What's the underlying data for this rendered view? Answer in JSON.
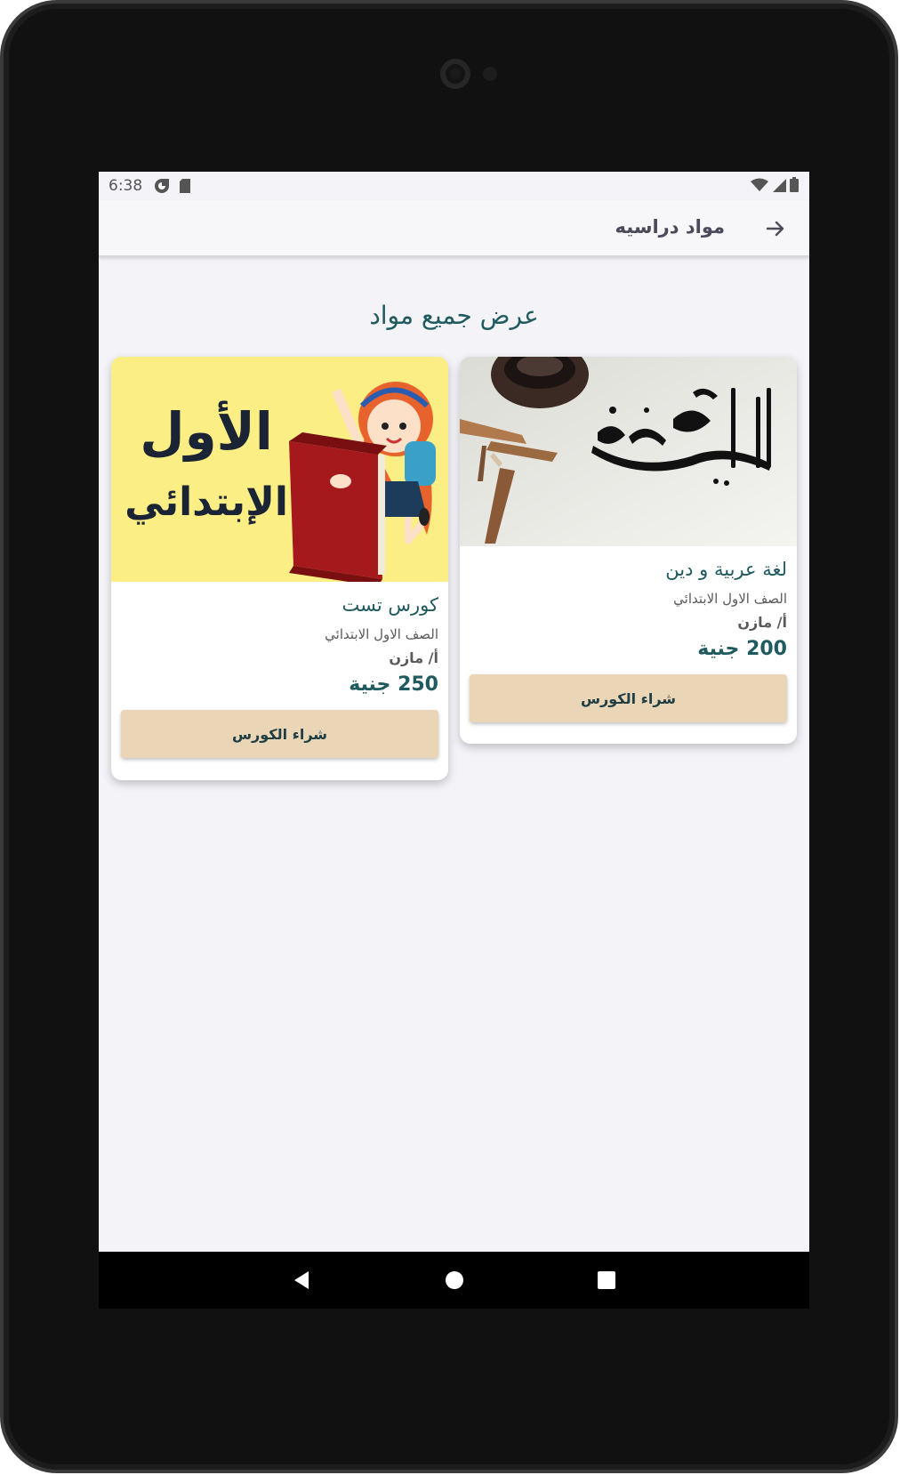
{
  "status_bar": {
    "time": "6:38"
  },
  "app_bar": {
    "title": "مواد دراسيه"
  },
  "section": {
    "title": "عرض جميع مواد"
  },
  "courses": [
    {
      "title": "لغة عربية و دين",
      "grade": "الصف الاول الابتدائي",
      "teacher": "أ/ مازن",
      "price": "200 جنية",
      "button": "شراء الكورس",
      "image_text": "اللغة العربية"
    },
    {
      "title": "كورس تست",
      "grade": "الصف الاول الابتدائي",
      "teacher": "أ/ مازن",
      "price": "250 جنية",
      "button": "شراء الكورس",
      "image_text_line1": "الأول",
      "image_text_line2": "الإبتدائي"
    }
  ],
  "colors": {
    "accent": "#1e5a5e",
    "button": "#ead5b7",
    "card_image_yellow": "#fbee84"
  },
  "icons": [
    "arrow-forward-icon",
    "back-triangle-icon",
    "home-circle-icon",
    "recents-square-icon",
    "wifi-icon",
    "signal-icon",
    "battery-icon",
    "sim-icon",
    "app-notification-icon"
  ]
}
